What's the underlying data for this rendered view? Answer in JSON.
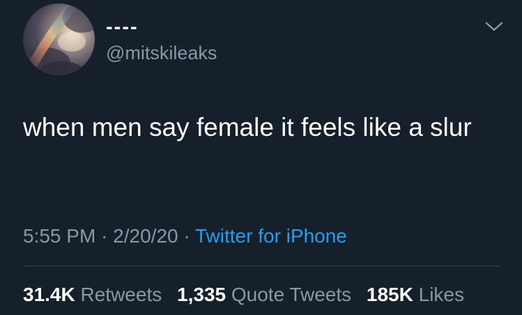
{
  "user": {
    "display_name": "----",
    "handle": "@mitskileaks",
    "avatar_icon": "sky-clouds-avatar"
  },
  "tweet": {
    "text": "when men say female it feels like a slur"
  },
  "meta": {
    "time": "5:55 PM",
    "separator": " · ",
    "date": "2/20/20",
    "source": "Twitter for iPhone"
  },
  "stats": {
    "retweets_count": "31.4K",
    "retweets_label": "Retweets",
    "quote_count": "1,335",
    "quote_label": "Quote Tweets",
    "likes_count": "185K",
    "likes_label": "Likes"
  },
  "icons": {
    "menu": "chevron-down-icon"
  },
  "colors": {
    "background": "#15202b",
    "primary_text": "#ffffff",
    "secondary_text": "#8899a6",
    "link": "#1da1f2",
    "divider": "#38444d"
  }
}
